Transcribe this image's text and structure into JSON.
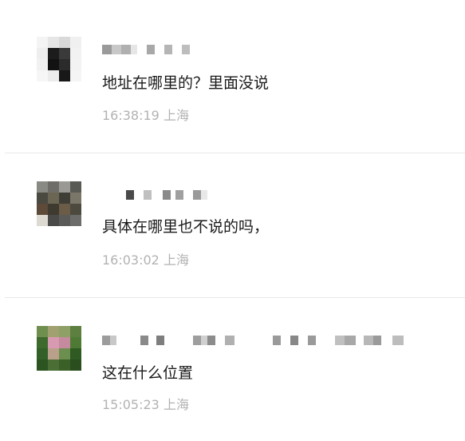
{
  "comments": [
    {
      "text": "地址在哪里的？里面没说",
      "time": "16:38:19",
      "location": "上海"
    },
    {
      "text": "具体在哪里也不说的吗，",
      "time": "16:03:02",
      "location": "上海"
    },
    {
      "text": "这在什么位置",
      "time": "15:05:23",
      "location": "上海"
    }
  ],
  "colors": {
    "text": "#1a1a1a",
    "meta": "#b2b2b2",
    "divider": "#e8e8e8"
  }
}
